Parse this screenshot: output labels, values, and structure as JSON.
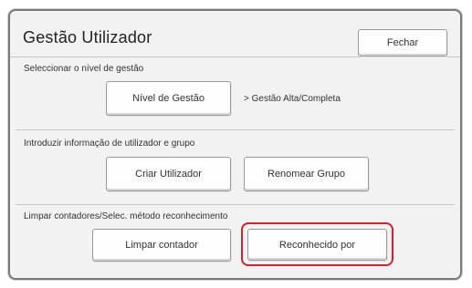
{
  "window": {
    "title": "Gestão Utilizador"
  },
  "header": {
    "close_label": "Fechar"
  },
  "sections": {
    "level": {
      "label": "Seleccionar o nível de gestão",
      "button_label": "Nível de Gestão",
      "current_value": "> Gestão Alta/Completa"
    },
    "user_info": {
      "label": "Introduzir informação de utilizador e grupo",
      "create_user_label": "Criar Utilizador",
      "rename_group_label": "Renomear Grupo"
    },
    "counters": {
      "label": "Limpar contadores/Selec. método reconhecimento",
      "clear_counter_label": "Limpar contador",
      "recognized_by_label": "Reconhecido por"
    }
  },
  "colors": {
    "highlight": "#d3212d"
  }
}
